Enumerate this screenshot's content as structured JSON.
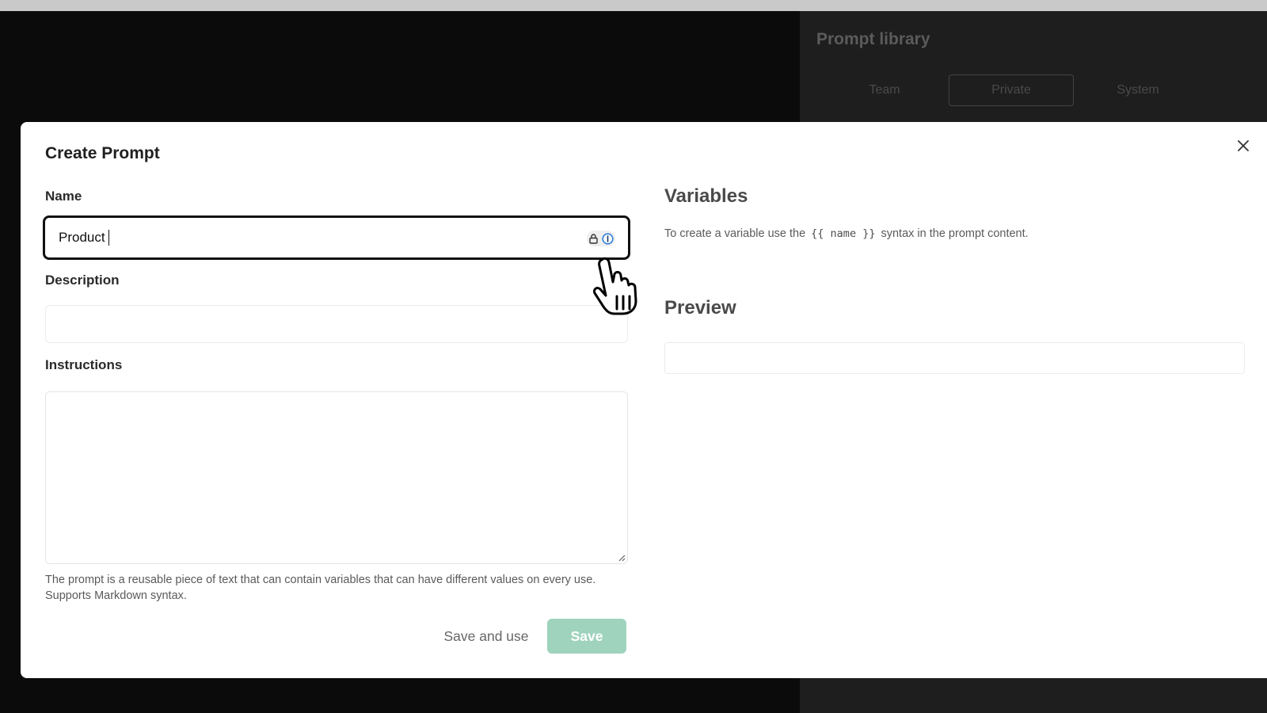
{
  "background": {
    "library_title": "Prompt library",
    "tabs": [
      {
        "label": "Team",
        "active": false
      },
      {
        "label": "Private",
        "active": true
      },
      {
        "label": "System",
        "active": false
      }
    ]
  },
  "modal": {
    "title": "Create Prompt",
    "close_icon": "close-icon",
    "name": {
      "label": "Name",
      "value": "Product",
      "password_manager_icons": [
        "lock-icon",
        "info-icon"
      ]
    },
    "description": {
      "label": "Description",
      "value": ""
    },
    "instructions": {
      "label": "Instructions",
      "value": "",
      "help": "The prompt is a reusable piece of text that can contain variables that can have different values on every use. Supports Markdown syntax."
    },
    "buttons": {
      "save_and_use": "Save and use",
      "save": "Save"
    },
    "variables": {
      "title": "Variables",
      "help_prefix": "To create a variable use the",
      "help_code": "{{ name }}",
      "help_suffix": "syntax in the prompt content."
    },
    "preview": {
      "title": "Preview",
      "value": ""
    }
  },
  "colors": {
    "save_button": "#9fd3bd",
    "overlay": "#0b0b0b",
    "input_focus_border": "#111111"
  }
}
